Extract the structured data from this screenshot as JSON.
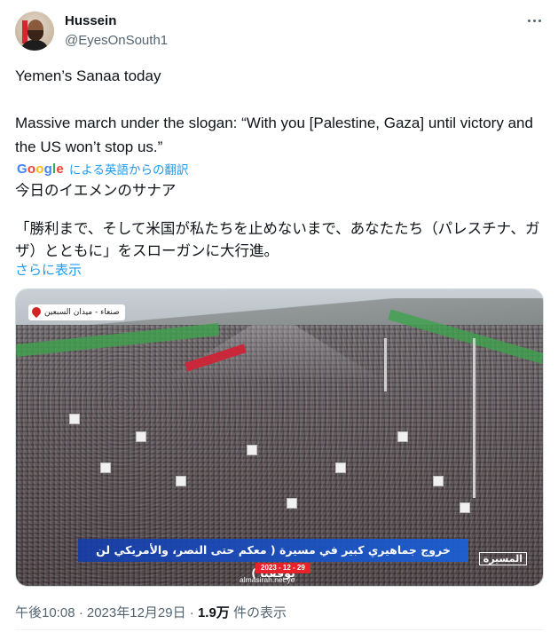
{
  "author": {
    "name": "Hussein",
    "handle": "@EyesOnSouth1"
  },
  "tweet": {
    "line1": "Yemen’s Sanaa today",
    "line2": "Massive march under the slogan: “With you [Palestine, Gaza] until victory and the US won’t stop us.”",
    "translation_provider": "Google",
    "translation_label": "による英語からの翻訳",
    "translated_line1": "今日のイエメンのサナア",
    "translated_line2": "「勝利まで、そして米国が私たちを止めないまで、あなたたち（パレスチナ、ガザ）とともに」をスローガンに大行進。",
    "show_more": "さらに表示"
  },
  "media": {
    "location_tag": "صنعاء - ميدان السبعين",
    "caption": "خروج جماهيري كبير في مسيرة ( معكم حتى النصر، والأمريكي لن يوقفنا )",
    "date_tag": "2023 - 12 - 29",
    "site": "almasirah.net.ye",
    "logo": "المسيرة"
  },
  "meta": {
    "time_date": "午後10:08 · 2023年12月29日 · ",
    "views_count": "1.9万",
    "views_label": " 件の表示"
  },
  "colors": {
    "link": "#1d9bf0",
    "secondary_text": "#536471",
    "caption_bar": "#1c5fd2",
    "date_tag": "#e8222b"
  }
}
